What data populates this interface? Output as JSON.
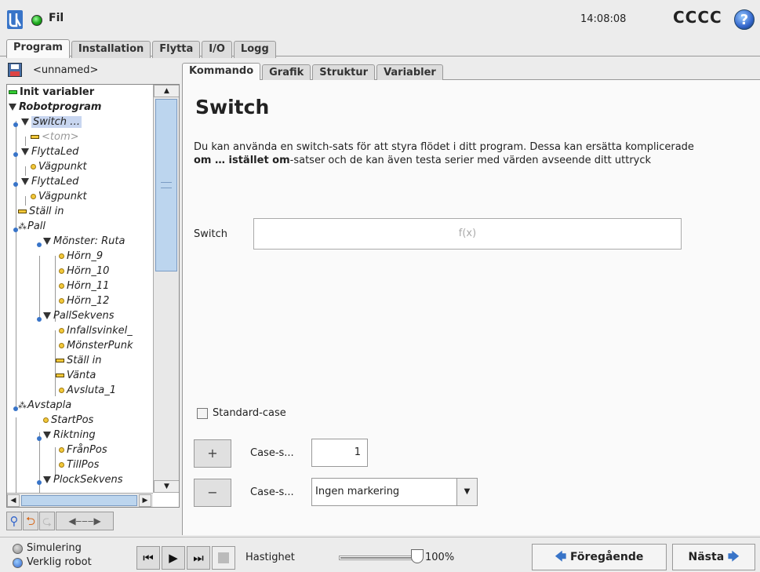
{
  "header": {
    "file_menu": "Fil",
    "clock": "14:08:08",
    "robot_name": "CCCC",
    "help": "?"
  },
  "main_tabs": [
    "Program",
    "Installation",
    "Flytta",
    "I/O",
    "Logg"
  ],
  "program_name": "<unnamed>",
  "tree": [
    {
      "label": "Init variabler"
    },
    {
      "label": "Robotprogram"
    },
    {
      "label": "Switch …"
    },
    {
      "label": "<tom>"
    },
    {
      "label": "FlyttaLed"
    },
    {
      "label": "Vägpunkt"
    },
    {
      "label": "FlyttaLed"
    },
    {
      "label": "Vägpunkt"
    },
    {
      "label": "Ställ in"
    },
    {
      "label": "Pall"
    },
    {
      "label": "Mönster: Ruta"
    },
    {
      "label": "Hörn_9"
    },
    {
      "label": "Hörn_10"
    },
    {
      "label": "Hörn_11"
    },
    {
      "label": "Hörn_12"
    },
    {
      "label": "PallSekvens"
    },
    {
      "label": "Infallsvinkel_"
    },
    {
      "label": "MönsterPunk"
    },
    {
      "label": "Ställ in"
    },
    {
      "label": "Vänta"
    },
    {
      "label": "Avsluta_1"
    },
    {
      "label": "Avstapla"
    },
    {
      "label": "StartPos"
    },
    {
      "label": "Riktning"
    },
    {
      "label": "FrånPos"
    },
    {
      "label": "TillPos"
    },
    {
      "label": "PlockSekvens"
    }
  ],
  "tree_tools": [
    "search-icon",
    "undo-icon",
    "redo-icon",
    "move-icon"
  ],
  "sub_tabs": [
    "Kommando",
    "Grafik",
    "Struktur",
    "Variabler"
  ],
  "content": {
    "title": "Switch",
    "desc_1": "Du kan använda en switch-sats för att styra flödet i ditt program. Dessa kan ersätta komplicerade ",
    "desc_bold_1": "om … istället om",
    "desc_2": "-satser och de kan även testa serier med värden avseende ditt uttryck",
    "switch_label": "Switch",
    "switch_expr": "f(x)",
    "default_case_label": "Standard-case",
    "default_case_checked": false,
    "add_label": "Case-s...",
    "add_icon": "+",
    "case_number": "1",
    "remove_label": "Case-s...",
    "remove_icon": "−",
    "case_select": "Ingen markering"
  },
  "footer": {
    "simulation": "Simulering",
    "real_robot": "Verklig robot",
    "speed_label": "Hastighet",
    "speed_value": "100%",
    "speed_fraction": 1.0,
    "prev": "Föregående",
    "next": "Nästa"
  },
  "colors": {
    "accent": "#3874c8",
    "selected": "#c8d6f0"
  }
}
